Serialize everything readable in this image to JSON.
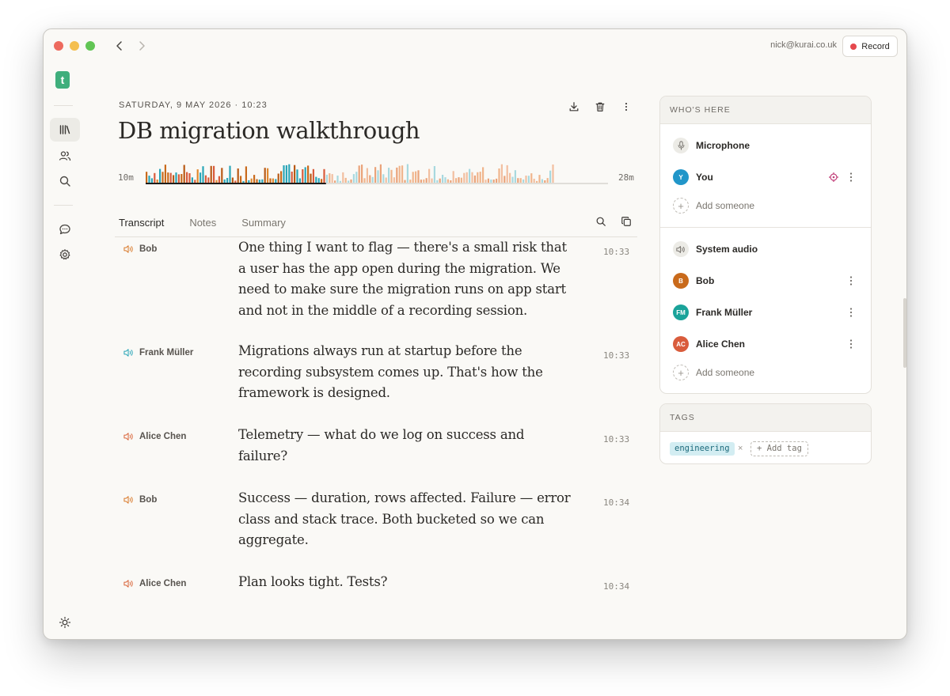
{
  "titlebar": {
    "account_email": "nick@kurai.co.uk",
    "record_label": "Record"
  },
  "sidebar": {
    "logo_letter": "t",
    "items": [
      {
        "icon": "library-icon",
        "active": true
      },
      {
        "icon": "people-icon",
        "active": false
      },
      {
        "icon": "search-icon",
        "active": false
      },
      {
        "icon": "chat-icon",
        "active": false
      },
      {
        "icon": "gear-icon",
        "active": false
      }
    ],
    "footer_icon": "sun-icon"
  },
  "meeting": {
    "date": "SATURDAY, 9 MAY 2026 · 10:23",
    "title": "DB migration walkthrough",
    "waveform_start": "10m",
    "waveform_end": "28m",
    "playback_progress": 0.39
  },
  "tabs": [
    {
      "label": "Transcript",
      "active": true
    },
    {
      "label": "Notes",
      "active": false
    },
    {
      "label": "Summary",
      "active": false
    }
  ],
  "transcript": [
    {
      "speaker": "Bob",
      "color": "#d97a2b",
      "text": "One thing I want to flag — there's a small risk that a user has the app open during the migration. We need to make sure the migration runs on app start and not in the middle of a recording session.",
      "time": "10:33"
    },
    {
      "speaker": "Frank Müller",
      "color": "#2aa6b8",
      "text": "Migrations always run at startup before the recording subsystem comes up. That's how the framework is designed.",
      "time": "10:33"
    },
    {
      "speaker": "Alice Chen",
      "color": "#d9663b",
      "text": "Telemetry — what do we log on success and failure?",
      "time": "10:33"
    },
    {
      "speaker": "Bob",
      "color": "#d97a2b",
      "text": "Success — duration, rows affected. Failure — error class and stack trace. Both bucketed so we can aggregate.",
      "time": "10:34"
    },
    {
      "speaker": "Alice Chen",
      "color": "#d9663b",
      "text": "Plan looks tight. Tests?",
      "time": "10:34"
    }
  ],
  "participants": {
    "title": "WHO'S HERE",
    "microphone_label": "Microphone",
    "mic_people": [
      {
        "initials": "Y",
        "name": "You",
        "color": "#2196c9"
      }
    ],
    "system_audio_label": "System audio",
    "system_people": [
      {
        "initials": "B",
        "name": "Bob",
        "color": "#c96a1b"
      },
      {
        "initials": "FM",
        "name": "Frank Müller",
        "color": "#1aa39a"
      },
      {
        "initials": "AC",
        "name": "Alice Chen",
        "color": "#d95c3c"
      }
    ],
    "add_label": "Add someone"
  },
  "tags": {
    "title": "TAGS",
    "items": [
      "engineering"
    ],
    "add_label": "+ Add tag"
  }
}
